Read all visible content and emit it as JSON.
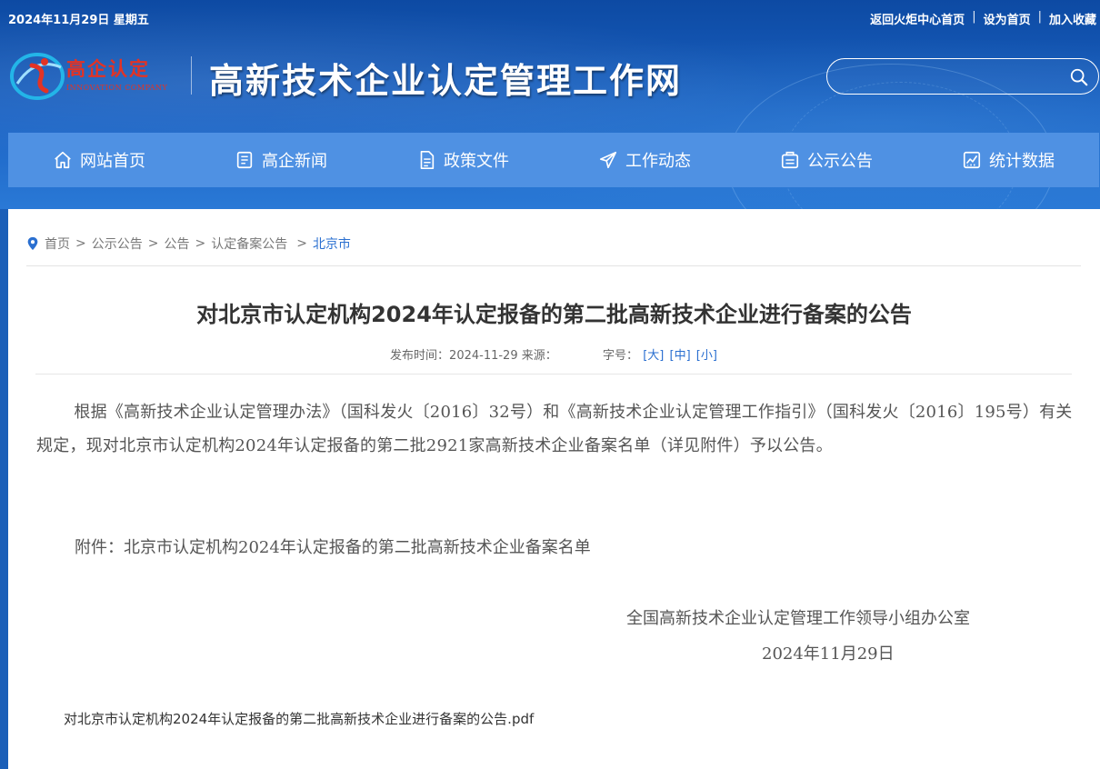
{
  "topbar": {
    "date": "2024年11月29日 星期五",
    "links": [
      "返回火炬中心首页",
      "设为首页",
      "加入收藏"
    ],
    "separator": "|"
  },
  "logo": {
    "name": "高企认定",
    "subtitle": "INNOVATION COMPANY",
    "brand_color": "#e23325"
  },
  "site_title": "高新技术企业认定管理工作网",
  "search": {
    "placeholder": "",
    "icon": "search-icon"
  },
  "nav": {
    "items": [
      {
        "label": "网站首页",
        "icon": "home-icon"
      },
      {
        "label": "高企新闻",
        "icon": "news-icon"
      },
      {
        "label": "政策文件",
        "icon": "document-icon"
      },
      {
        "label": "工作动态",
        "icon": "paper-plane-icon"
      },
      {
        "label": "公示公告",
        "icon": "notice-icon"
      },
      {
        "label": "统计数据",
        "icon": "chart-icon"
      }
    ],
    "color": "#4f91e3"
  },
  "breadcrumb": {
    "items": [
      "首页",
      "公示公告",
      "公告",
      "认定备案公告"
    ],
    "current": "北京市",
    "separator": ">"
  },
  "article": {
    "title": "对北京市认定机构2024年认定报备的第二批高新技术企业进行备案的公告",
    "meta": {
      "publish_label": "发布时间：2024-11-29",
      "source_label": "来源：",
      "font_size_label": "字号：",
      "size_large": "[大]",
      "size_medium": "[中]",
      "size_small": "[小]"
    },
    "body": "根据《高新技术企业认定管理办法》（国科发火〔2016〕32号）和《高新技术企业认定管理工作指引》（国科发火〔2016〕195号）有关规定，现对北京市认定机构2024年认定报备的第二批2921家高新技术企业备案名单（详见附件）予以公告。",
    "attachment_line": "附件：北京市认定机构2024年认定报备的第二批高新技术企业备案名单",
    "signature_org": "全国高新技术企业认定管理工作领导小组办公室",
    "signature_date": "2024年11月29日",
    "pdf_link": "对北京市认定机构2024年认定报备的第二批高新技术企业进行备案的公告.pdf"
  },
  "colors": {
    "link": "#2a6fd0",
    "banner": "#1b5fb8"
  }
}
